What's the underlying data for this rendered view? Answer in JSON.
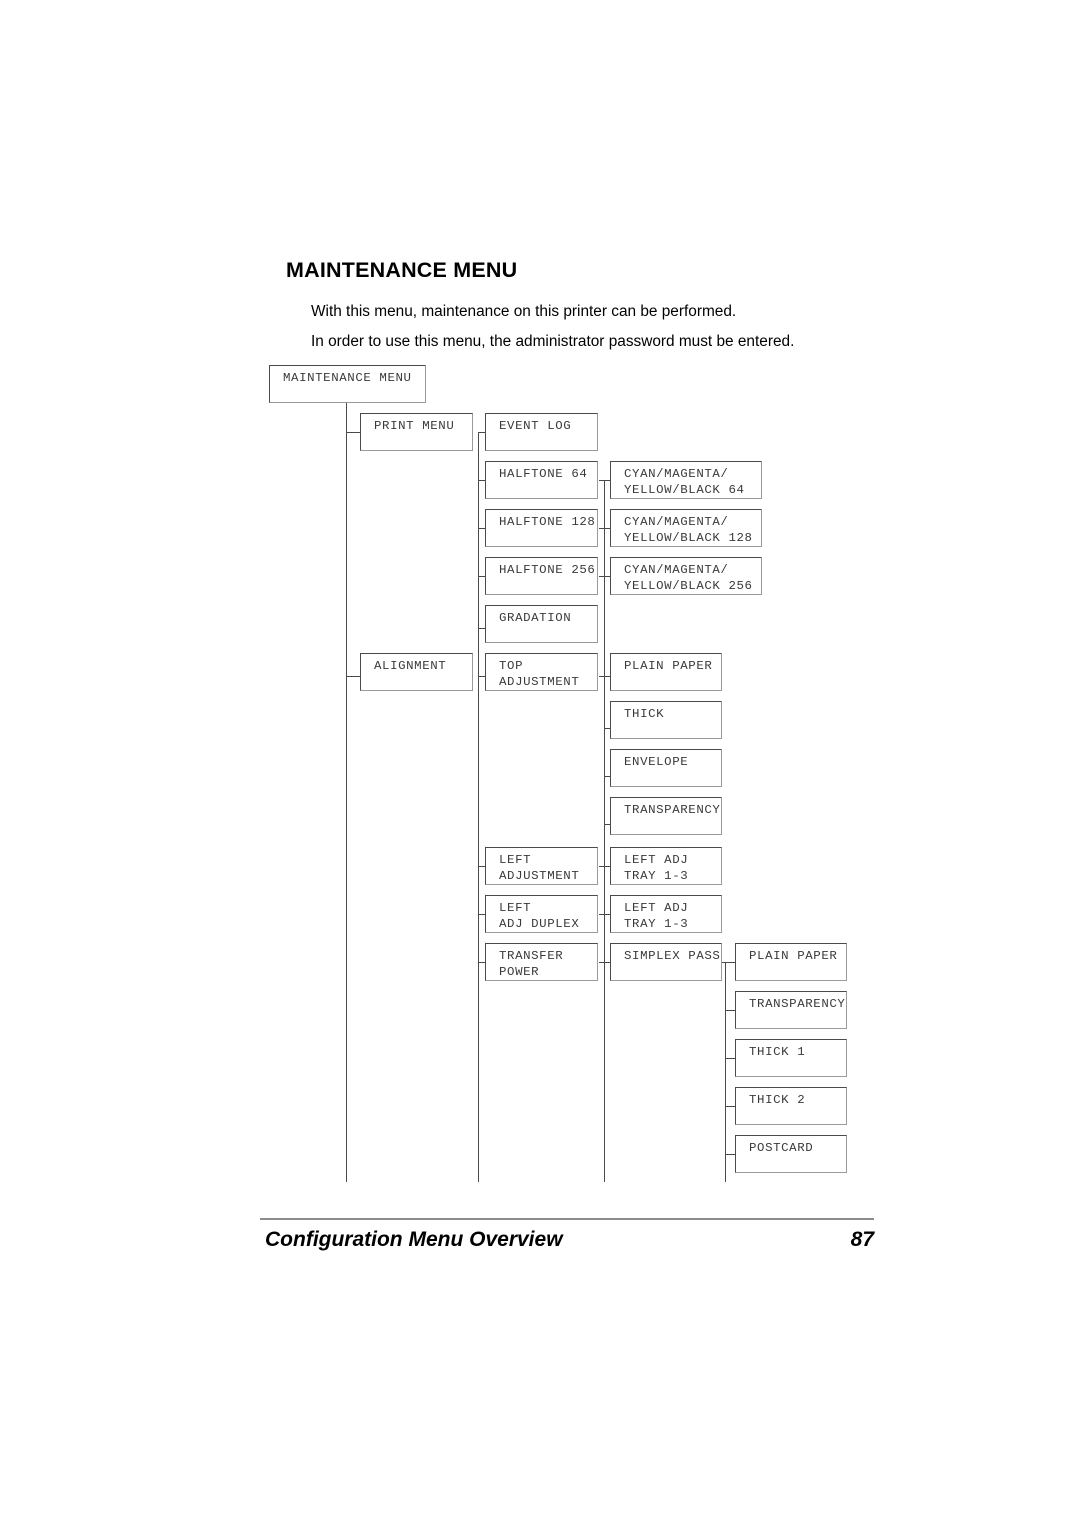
{
  "document": {
    "heading": "MAINTENANCE MENU",
    "paragraphs": [
      "With this menu, maintenance on this printer can be performed.",
      "In order to use this menu, the administrator password must be entered."
    ],
    "footer": {
      "title": "Configuration Menu Overview",
      "page_number": "87"
    }
  },
  "diagram": {
    "root": "MAINTENANCE MENU",
    "nodes": {
      "root": "MAINTENANCE MENU",
      "print_menu": "PRINT MENU",
      "event_log": "EVENT LOG",
      "halftone_64": "HALFTONE 64",
      "cmyk_64": "CYAN/MAGENTA/\nYELLOW/BLACK 64",
      "halftone_128": "HALFTONE 128",
      "cmyk_128": "CYAN/MAGENTA/\nYELLOW/BLACK 128",
      "halftone_256": "HALFTONE 256",
      "cmyk_256": "CYAN/MAGENTA/\nYELLOW/BLACK 256",
      "gradation": "GRADATION",
      "alignment": "ALIGNMENT",
      "top_adjustment": "TOP\nADJUSTMENT",
      "plain_paper_top": "PLAIN PAPER",
      "thick": "THICK",
      "envelope": "ENVELOPE",
      "transparency": "TRANSPARENCY",
      "left_adjustment": "LEFT\nADJUSTMENT",
      "left_adj_tray": "LEFT ADJ\nTRAY 1-3",
      "left_adj_duplex": "LEFT\nADJ DUPLEX",
      "left_adj_tray_duplex": "LEFT ADJ\nTRAY 1-3",
      "transfer_power": "TRANSFER\nPOWER",
      "simplex_pass": "SIMPLEX PASS",
      "plain_paper_simplex": "PLAIN PAPER",
      "transparency_simplex": "TRANSPARENCY",
      "thick_1": "THICK 1",
      "thick_2": "THICK 2",
      "postcard": "POSTCARD"
    }
  },
  "colors": {
    "border": "#4a4a4a",
    "border_light": "#9a9a9a",
    "text": "#3a3a3a",
    "rule": "#8c8c8c"
  }
}
